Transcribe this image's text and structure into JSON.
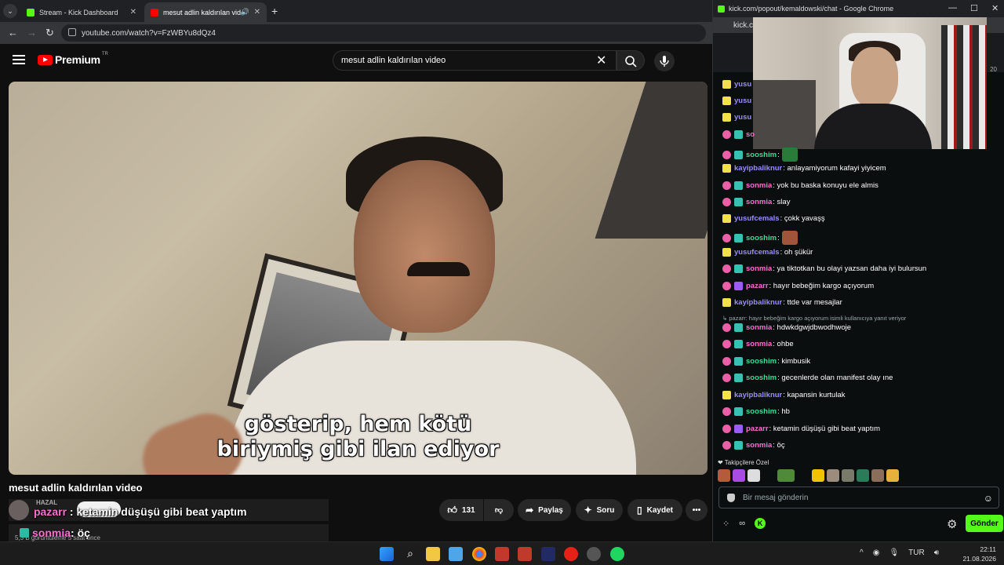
{
  "browser": {
    "tabs": [
      {
        "label": "Stream - Kick Dashboard"
      },
      {
        "label": "mesut adlin kaldırılan video"
      }
    ],
    "url": "youtube.com/watch?v=FzWBYu8dQz4"
  },
  "youtube": {
    "logo_text": "Premium",
    "logo_region": "TR",
    "search_value": "mesut adlin kaldırılan video",
    "caption_line1": "gösterip, hem kötü",
    "caption_line2": "biriymiş gibi ilan ediyor",
    "video_title": "mesut adlin kaldırılan video",
    "channel_name": "HAZAL",
    "meta": "5,3 B görüntüleme  5 saat önce",
    "like_count": "131",
    "share_label": "Paylaş",
    "ask_label": "Soru",
    "save_label": "Kaydet",
    "overlay_chat": [
      {
        "user": "pazarr",
        "text": " : ketamin düşüşü gibi beat yaptım"
      },
      {
        "user": "sonmia",
        "text": " : öç"
      }
    ]
  },
  "popup": {
    "title": "kick.com/popout/kemaldowski/chat - Google Chrome",
    "url": "kick.c",
    "viewer_count": "20",
    "messages": [
      {
        "badges": [
          "y"
        ],
        "user": "yusu",
        "color": "#9b8cff",
        "text": ""
      },
      {
        "badges": [
          "y"
        ],
        "user": "yusu",
        "color": "#9b8cff",
        "text": ""
      },
      {
        "badges": [
          "y"
        ],
        "user": "yusu",
        "color": "#9b8cff",
        "text": ""
      },
      {
        "badges": [
          "p",
          "t"
        ],
        "user": "so",
        "color": "#ff6ed0",
        "text": ""
      },
      {
        "badges": [
          "p",
          "t"
        ],
        "user": "sooshim",
        "color": "#3ddc97",
        "text": ":"
      },
      {
        "badges": [
          "y"
        ],
        "user": "kayipbaliknur",
        "color": "#9b8cff",
        "text": ": anlayamiyorum kafayi yiyicem"
      },
      {
        "badges": [
          "p",
          "t"
        ],
        "user": "sonmia",
        "color": "#ff6ed0",
        "text": ": yok bu baska konuyu ele almis"
      },
      {
        "badges": [
          "p",
          "t"
        ],
        "user": "sonmia",
        "color": "#ff6ed0",
        "text": ": slay"
      },
      {
        "badges": [
          "y"
        ],
        "user": "yusufcemals",
        "color": "#9b8cff",
        "text": ": çokk yavaşş"
      },
      {
        "badges": [
          "p",
          "t"
        ],
        "user": "sooshim",
        "color": "#3ddc97",
        "text": ":"
      },
      {
        "badges": [
          "y"
        ],
        "user": "yusufcemals",
        "color": "#9b8cff",
        "text": ": oh şükür"
      },
      {
        "badges": [
          "p",
          "t"
        ],
        "user": "sonmia",
        "color": "#ff6ed0",
        "text": ": ya tiktotkan bu olayi yazsan daha iyi bulursun"
      },
      {
        "badges": [
          "p",
          "v"
        ],
        "user": "pazarr",
        "color": "#ff6ed0",
        "text": ": hayır bebeğim kargo açıyorum"
      },
      {
        "badges": [
          "y"
        ],
        "user": "kayipbaliknur",
        "color": "#9b8cff",
        "text": ": ttde var mesajlar"
      },
      {
        "badges": [
          "p",
          "t"
        ],
        "user": "sonmia",
        "color": "#ff6ed0",
        "text": ": hdwkdgwjdbwodhwoje"
      },
      {
        "badges": [
          "p",
          "t"
        ],
        "user": "sonmia",
        "color": "#ff6ed0",
        "text": ": ohbe"
      },
      {
        "badges": [
          "p",
          "t"
        ],
        "user": "sooshim",
        "color": "#3ddc97",
        "text": ": kimbusik"
      },
      {
        "badges": [
          "p",
          "t"
        ],
        "user": "sooshim",
        "color": "#3ddc97",
        "text": ": gecenlerde olan manifest olay ıne"
      },
      {
        "badges": [
          "y"
        ],
        "user": "kayipbaliknur",
        "color": "#9b8cff",
        "text": ": kapansin kurtulak"
      },
      {
        "badges": [
          "p",
          "t"
        ],
        "user": "sooshim",
        "color": "#3ddc97",
        "text": ": hb"
      },
      {
        "badges": [
          "p",
          "v"
        ],
        "user": "pazarr",
        "color": "#ff6ed0",
        "text": ": ketamin düşüşü gibi beat yaptım"
      },
      {
        "badges": [
          "p",
          "t"
        ],
        "user": "sonmia",
        "color": "#ff6ed0",
        "text": ": öç"
      }
    ],
    "reply_note": "pazarr: hayır bebeğim kargo açıyorum isimli kullanıcıya yanıt veriyor",
    "subs_only_label": "Takipçilere Özel",
    "input_placeholder": "Bir mesaj gönderin",
    "send_label": "Gönder"
  },
  "taskbar": {
    "language": "TUR",
    "time": "22:11",
    "date": "21.08.2026"
  },
  "colors": {
    "kick_green": "#53fc18",
    "youtube_red": "#ff0000"
  }
}
